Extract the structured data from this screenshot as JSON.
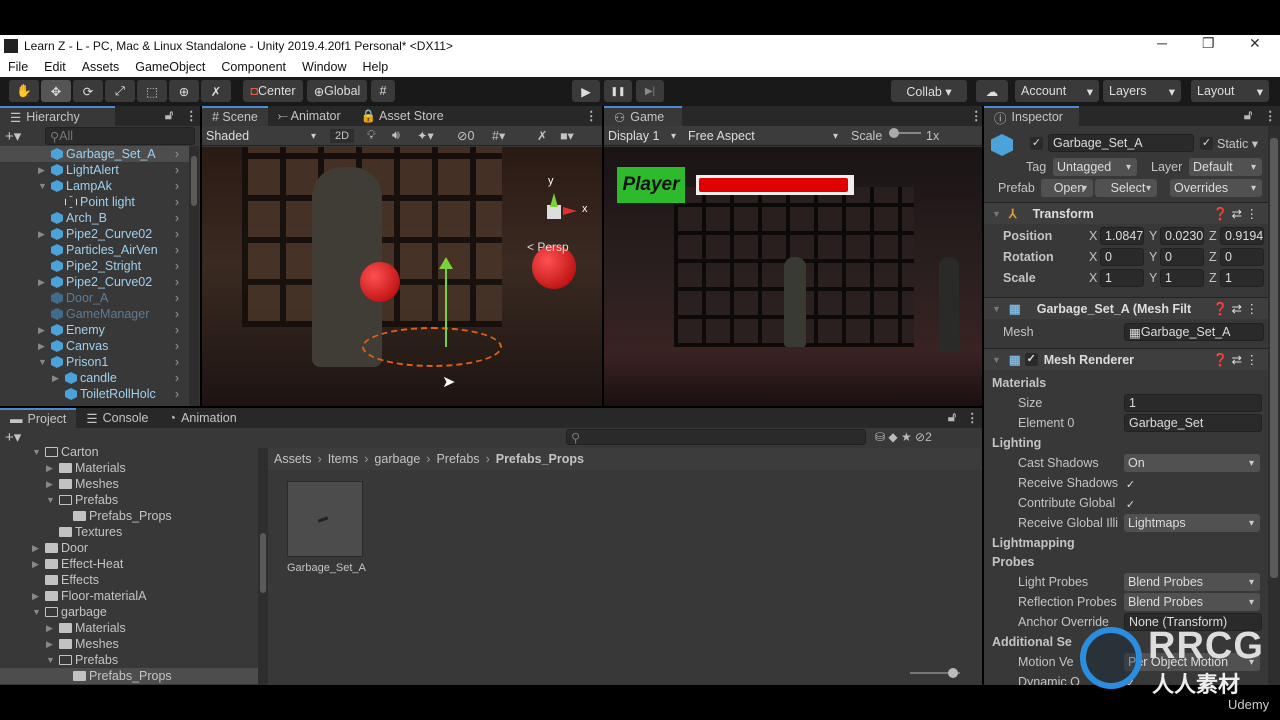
{
  "window": {
    "title": "Learn Z - L - PC, Mac & Linux Standalone - Unity 2019.4.20f1 Personal* <DX11>",
    "minimize": "─",
    "maximize": "❐",
    "close": "✕"
  },
  "menu": [
    "File",
    "Edit",
    "Assets",
    "GameObject",
    "Component",
    "Window",
    "Help"
  ],
  "toolbar": {
    "tools": [
      "✋",
      "✥",
      "⟳",
      "⤢",
      "⬚",
      "⊕",
      "✗"
    ],
    "center": "Center",
    "global": "Global",
    "play": "▶",
    "pause": "❚❚",
    "step": "▶|",
    "collab": "Collab ▾",
    "cloud": "☁",
    "account": "Account",
    "layers": "Layers",
    "layout": "Layout"
  },
  "hierarchy": {
    "tab": "Hierarchy",
    "search_placeholder": "All",
    "items": [
      {
        "label": "Garbage_Set_A",
        "indent": 1,
        "exp": "",
        "sel": true
      },
      {
        "label": "LightAlert",
        "indent": 1,
        "exp": "▶"
      },
      {
        "label": "LampAk",
        "indent": 1,
        "exp": "▼"
      },
      {
        "label": "Point light",
        "indent": 2,
        "exp": "",
        "outline": true
      },
      {
        "label": "Arch_B",
        "indent": 1,
        "exp": ""
      },
      {
        "label": "Pipe2_Curve02",
        "indent": 1,
        "exp": "▶"
      },
      {
        "label": "Particles_AirVen",
        "indent": 1,
        "exp": ""
      },
      {
        "label": "Pipe2_Stright",
        "indent": 1,
        "exp": ""
      },
      {
        "label": "Pipe2_Curve02",
        "indent": 1,
        "exp": "▶"
      },
      {
        "label": "Door_A",
        "indent": 1,
        "exp": "",
        "dim": true
      },
      {
        "label": "GameManager",
        "indent": 1,
        "exp": "",
        "dim": true
      },
      {
        "label": "Enemy",
        "indent": 1,
        "exp": "▶"
      },
      {
        "label": "Canvas",
        "indent": 1,
        "exp": "▶"
      },
      {
        "label": "Prison1",
        "indent": 1,
        "exp": "▼"
      },
      {
        "label": "candle",
        "indent": 2,
        "exp": "▶"
      },
      {
        "label": "ToiletRollHolc",
        "indent": 2,
        "exp": ""
      }
    ]
  },
  "scene": {
    "tabs": [
      "# Scene",
      "⤚ Animator",
      "🔒 Asset Store"
    ],
    "shading": "Shaded",
    "mode_2d": "2D",
    "gizmo_hidden_count": "0",
    "persp": "< Persp",
    "axis_y": "y",
    "axis_x": "x"
  },
  "game": {
    "tab": "Game",
    "display": "Display 1",
    "aspect": "Free Aspect",
    "scale_label": "Scale",
    "scale_value": "1x",
    "player_label": "Player",
    "health": 0.98,
    "health_color": "#e00000"
  },
  "project": {
    "tabs": [
      "Project",
      "Console",
      "Animation"
    ],
    "tree": [
      {
        "label": "Carton",
        "indent": 2,
        "exp": "▼",
        "open": true
      },
      {
        "label": "Materials",
        "indent": 3,
        "exp": "▶"
      },
      {
        "label": "Meshes",
        "indent": 3,
        "exp": "▶"
      },
      {
        "label": "Prefabs",
        "indent": 3,
        "exp": "▼",
        "open": true
      },
      {
        "label": "Prefabs_Props",
        "indent": 4,
        "exp": ""
      },
      {
        "label": "Textures",
        "indent": 3,
        "exp": ""
      },
      {
        "label": "Door",
        "indent": 2,
        "exp": "▶"
      },
      {
        "label": "Effect-Heat",
        "indent": 2,
        "exp": "▶"
      },
      {
        "label": "Effects",
        "indent": 2,
        "exp": ""
      },
      {
        "label": "Floor-materialA",
        "indent": 2,
        "exp": "▶"
      },
      {
        "label": "garbage",
        "indent": 2,
        "exp": "▼",
        "open": true
      },
      {
        "label": "Materials",
        "indent": 3,
        "exp": "▶"
      },
      {
        "label": "Meshes",
        "indent": 3,
        "exp": "▶"
      },
      {
        "label": "Prefabs",
        "indent": 3,
        "exp": "▼",
        "open": true
      },
      {
        "label": "Prefabs_Props",
        "indent": 4,
        "exp": "",
        "sel": true
      }
    ],
    "breadcrumb": [
      "Assets",
      "Items",
      "garbage",
      "Prefabs",
      "Prefabs_Props"
    ],
    "asset": "Garbage_Set_A",
    "hidden_count": "2"
  },
  "inspector": {
    "tab": "Inspector",
    "name": "Garbage_Set_A",
    "static": "Static",
    "tag_label": "Tag",
    "tag": "Untagged",
    "layer_label": "Layer",
    "layer": "Default",
    "prefab_label": "Prefab",
    "open": "Open",
    "select": "Select",
    "overrides": "Overrides",
    "transform": {
      "title": "Transform",
      "rows": [
        {
          "label": "Position",
          "x": "1.0847",
          "y": "0.0230",
          "z": "0.9194"
        },
        {
          "label": "Rotation",
          "x": "0",
          "y": "0",
          "z": "0"
        },
        {
          "label": "Scale",
          "x": "1",
          "y": "1",
          "z": "1"
        }
      ]
    },
    "mesh_filter": {
      "title": "Garbage_Set_A (Mesh Filt",
      "mesh_label": "Mesh",
      "mesh": "Garbage_Set_A"
    },
    "mesh_renderer": {
      "title": "Mesh Renderer",
      "materials": "Materials",
      "size_label": "Size",
      "size": "1",
      "element0_label": "Element 0",
      "element0": "Garbage_Set",
      "lighting": "Lighting",
      "cast_label": "Cast Shadows",
      "cast": "On",
      "recv_label": "Receive Shadows",
      "contrib_label": "Contribute Global",
      "recv_gi_label": "Receive Global Illi",
      "recv_gi": "Lightmaps",
      "lightmapping": "Lightmapping",
      "probes": "Probes",
      "light_probes_label": "Light Probes",
      "light_probes": "Blend Probes",
      "refl_label": "Reflection Probes",
      "refl": "Blend Probes",
      "anchor_label": "Anchor Override",
      "anchor": "None (Transform)",
      "additional": "Additional Se",
      "motion_label": "Motion Ve",
      "motion": "Per Object Motion",
      "dynamic_label": "Dynamic O"
    }
  },
  "watermark": {
    "text": "RRCG",
    "sub": "人人素材",
    "udemy": "Udemy"
  }
}
